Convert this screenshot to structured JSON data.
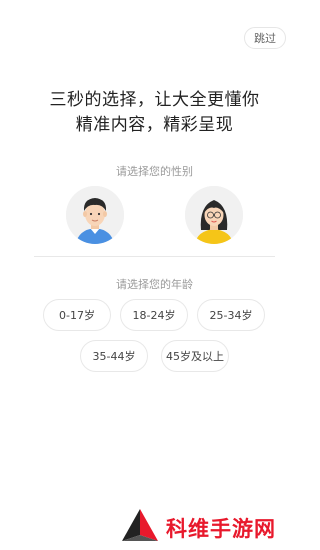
{
  "header": {
    "skip_label": "跳过"
  },
  "headline": {
    "line1": "三秒的选择，让大全更懂你",
    "line2": "精准内容，精彩呈现"
  },
  "gender": {
    "label": "请选择您的性别",
    "options": [
      {
        "name": "male",
        "color": "#4a90e2"
      },
      {
        "name": "female",
        "color": "#f5c518"
      }
    ]
  },
  "age": {
    "label": "请选择您的年龄",
    "options": [
      "0-17岁",
      "18-24岁",
      "25-34岁",
      "35-44岁",
      "45岁及以上"
    ]
  },
  "watermark": {
    "text": "科维手游网",
    "color": "#e8192c"
  }
}
